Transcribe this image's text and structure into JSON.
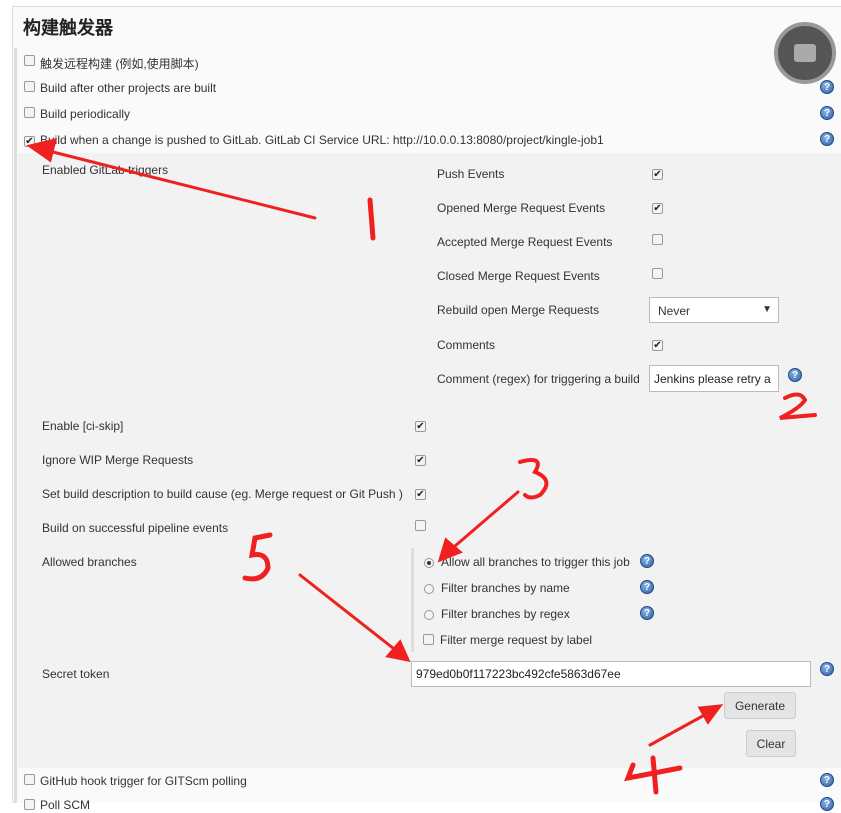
{
  "section_title": "构建触发器",
  "triggers": [
    {
      "label": "触发远程构建 (例如,使用脚本)",
      "checked": false
    },
    {
      "label": "Build after other projects are built",
      "checked": false
    },
    {
      "label": "Build periodically",
      "checked": false
    },
    {
      "label": "Build when a change is pushed to GitLab. GitLab CI Service URL: http://10.0.0.13:8080/project/kingle-job1",
      "checked": true
    }
  ],
  "gitlab": {
    "enabled_triggers_label": "Enabled GitLab triggers",
    "events": [
      {
        "label": "Push Events",
        "checked": true
      },
      {
        "label": "Opened Merge Request Events",
        "checked": true
      },
      {
        "label": "Accepted Merge Request Events",
        "checked": false
      },
      {
        "label": "Closed Merge Request Events",
        "checked": false
      }
    ],
    "rebuild_label": "Rebuild open Merge Requests",
    "rebuild_value": "Never",
    "comments_label": "Comments",
    "comments_checked": true,
    "comment_regex_label": "Comment (regex) for triggering a build",
    "comment_regex_value": "Jenkins please retry a build",
    "options": [
      {
        "label": "Enable [ci-skip]",
        "checked": true
      },
      {
        "label": "Ignore WIP Merge Requests",
        "checked": true
      },
      {
        "label": "Set build description to build cause (eg. Merge request or Git Push )",
        "checked": true
      },
      {
        "label": "Build on successful pipeline events",
        "checked": false
      }
    ],
    "allowed_branches_label": "Allowed branches",
    "branch_options": [
      {
        "label": "Allow all branches to trigger this job",
        "selected": true
      },
      {
        "label": "Filter branches by name",
        "selected": false
      },
      {
        "label": "Filter branches by regex",
        "selected": false
      }
    ],
    "filter_label": "Filter merge request by label",
    "secret_token_label": "Secret token",
    "secret_token_value": "979ed0b0f117223bc492cfe5863d67ee",
    "generate_label": "Generate",
    "clear_label": "Clear"
  },
  "more_triggers": [
    {
      "label": "GitHub hook trigger for GITScm polling",
      "checked": false
    },
    {
      "label": "Poll SCM",
      "checked": false
    }
  ],
  "help_glyph": "?",
  "annotation_color": "#f02020"
}
